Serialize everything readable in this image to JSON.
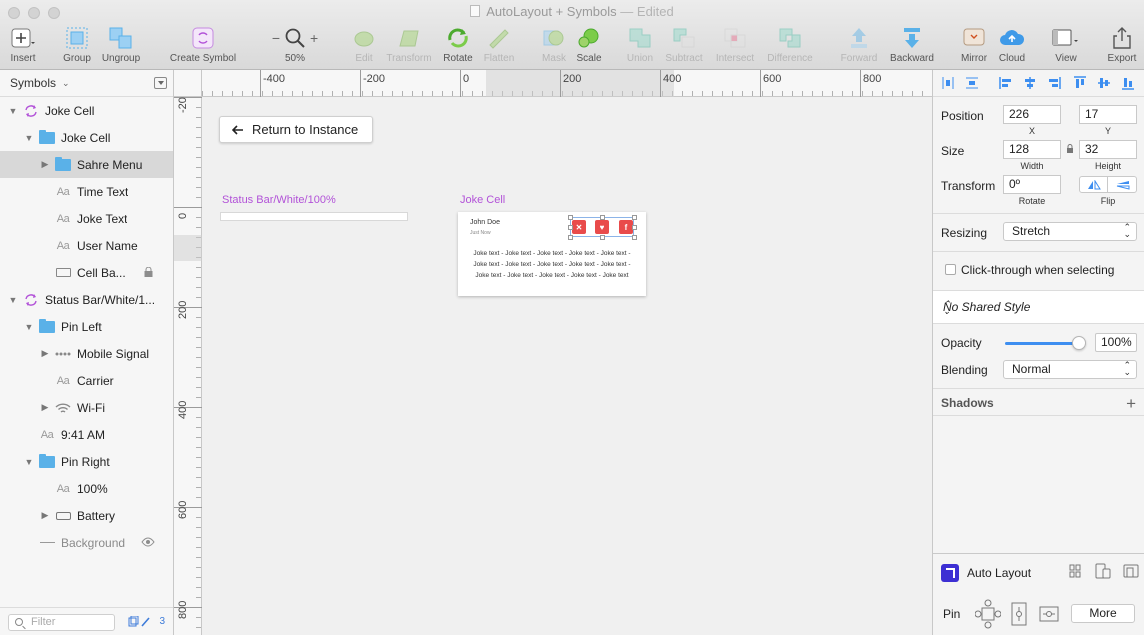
{
  "window": {
    "title": "AutoLayout + Symbols",
    "edited": " — Edited"
  },
  "toolbar": {
    "insert": "Insert",
    "group": "Group",
    "ungroup": "Ungroup",
    "create_symbol": "Create Symbol",
    "zoom_minus": "−",
    "zoom_plus": "+",
    "zoom_level": "50%",
    "edit": "Edit",
    "transform": "Transform",
    "rotate": "Rotate",
    "flatten": "Flatten",
    "mask": "Mask",
    "scale": "Scale",
    "union": "Union",
    "subtract": "Subtract",
    "intersect": "Intersect",
    "difference": "Difference",
    "forward": "Forward",
    "backward": "Backward",
    "mirror": "Mirror",
    "cloud": "Cloud",
    "view": "View",
    "export": "Export"
  },
  "sidebar": {
    "header": "Symbols",
    "filter_placeholder": "Filter",
    "layer_count": "3",
    "layers": [
      {
        "label": "Joke Cell",
        "kind": "symbol",
        "indent": 0,
        "disclosure": "open"
      },
      {
        "label": "Joke Cell",
        "kind": "folder",
        "indent": 1,
        "disclosure": "open"
      },
      {
        "label": "Sahre Menu",
        "kind": "folder",
        "indent": 2,
        "disclosure": "closed",
        "selected": true
      },
      {
        "label": "Time Text",
        "kind": "text",
        "indent": 2,
        "disclosure": "none"
      },
      {
        "label": "Joke Text",
        "kind": "text",
        "indent": 2,
        "disclosure": "none"
      },
      {
        "label": "User Name",
        "kind": "text",
        "indent": 2,
        "disclosure": "none"
      },
      {
        "label": "Cell Ba...",
        "kind": "rect",
        "indent": 2,
        "disclosure": "none",
        "locked": true
      },
      {
        "label": "Status Bar/White/1...",
        "kind": "symbol",
        "indent": 0,
        "disclosure": "open"
      },
      {
        "label": "Pin Left",
        "kind": "folder",
        "indent": 1,
        "disclosure": "open"
      },
      {
        "label": "Mobile Signal",
        "kind": "signal",
        "indent": 2,
        "disclosure": "closed"
      },
      {
        "label": "Carrier",
        "kind": "text",
        "indent": 2,
        "disclosure": "none"
      },
      {
        "label": "Wi-Fi",
        "kind": "wifi",
        "indent": 2,
        "disclosure": "closed"
      },
      {
        "label": "9:41 AM",
        "kind": "text",
        "indent": 1,
        "disclosure": "none"
      },
      {
        "label": "Pin Right",
        "kind": "folder",
        "indent": 1,
        "disclosure": "open"
      },
      {
        "label": "100%",
        "kind": "text",
        "indent": 2,
        "disclosure": "none"
      },
      {
        "label": "Battery",
        "kind": "battery",
        "indent": 2,
        "disclosure": "closed"
      },
      {
        "label": "Background",
        "kind": "line",
        "indent": 1,
        "disclosure": "none",
        "hidden": true
      }
    ]
  },
  "canvas": {
    "ruler_top_labels": [
      "-400",
      "-200",
      "0",
      "200",
      "400",
      "600",
      "800"
    ],
    "ruler_left_labels": [
      "-20",
      "0",
      "200",
      "400",
      "600",
      "800"
    ],
    "return_button": "Return to Instance",
    "artboards": {
      "status_bar": "Status Bar/White/100%",
      "joke_cell": "Joke Cell"
    },
    "joke_cell": {
      "user_name": "John Doe",
      "time": "Just Now",
      "joke_text": "Joke text - Joke text - Joke text - Joke text - Joke text - Joke text - Joke text - Joke text - Joke text - Joke text - Joke text - Joke text - Joke text - Joke text - Joke text",
      "share_buttons": [
        "✕",
        "♥",
        "f"
      ]
    }
  },
  "inspector": {
    "position_label": "Position",
    "x_value": "226",
    "y_value": "17",
    "x_caption": "X",
    "y_caption": "Y",
    "size_label": "Size",
    "width_value": "128",
    "height_value": "32",
    "width_caption": "Width",
    "height_caption": "Height",
    "transform_label": "Transform",
    "rotate_value": "0º",
    "rotate_caption": "Rotate",
    "flip_caption": "Flip",
    "resizing_label": "Resizing",
    "resizing_value": "Stretch",
    "clickthrough_label": "Click-through when selecting",
    "shared_style": "No Shared Style",
    "opacity_label": "Opacity",
    "opacity_value": "100%",
    "opacity_fraction": 1.0,
    "blending_label": "Blending",
    "blending_value": "Normal",
    "shadows_label": "Shadows",
    "autolayout_label": "Auto Layout",
    "pin_label": "Pin",
    "more_button": "More"
  },
  "colors": {
    "symbol_purple": "#b252d8",
    "folder_blue": "#5ab1e8",
    "accent_blue": "#3d8ef0",
    "share_red": "#e94b4b",
    "autolayout_indigo": "#3d2fd3"
  }
}
